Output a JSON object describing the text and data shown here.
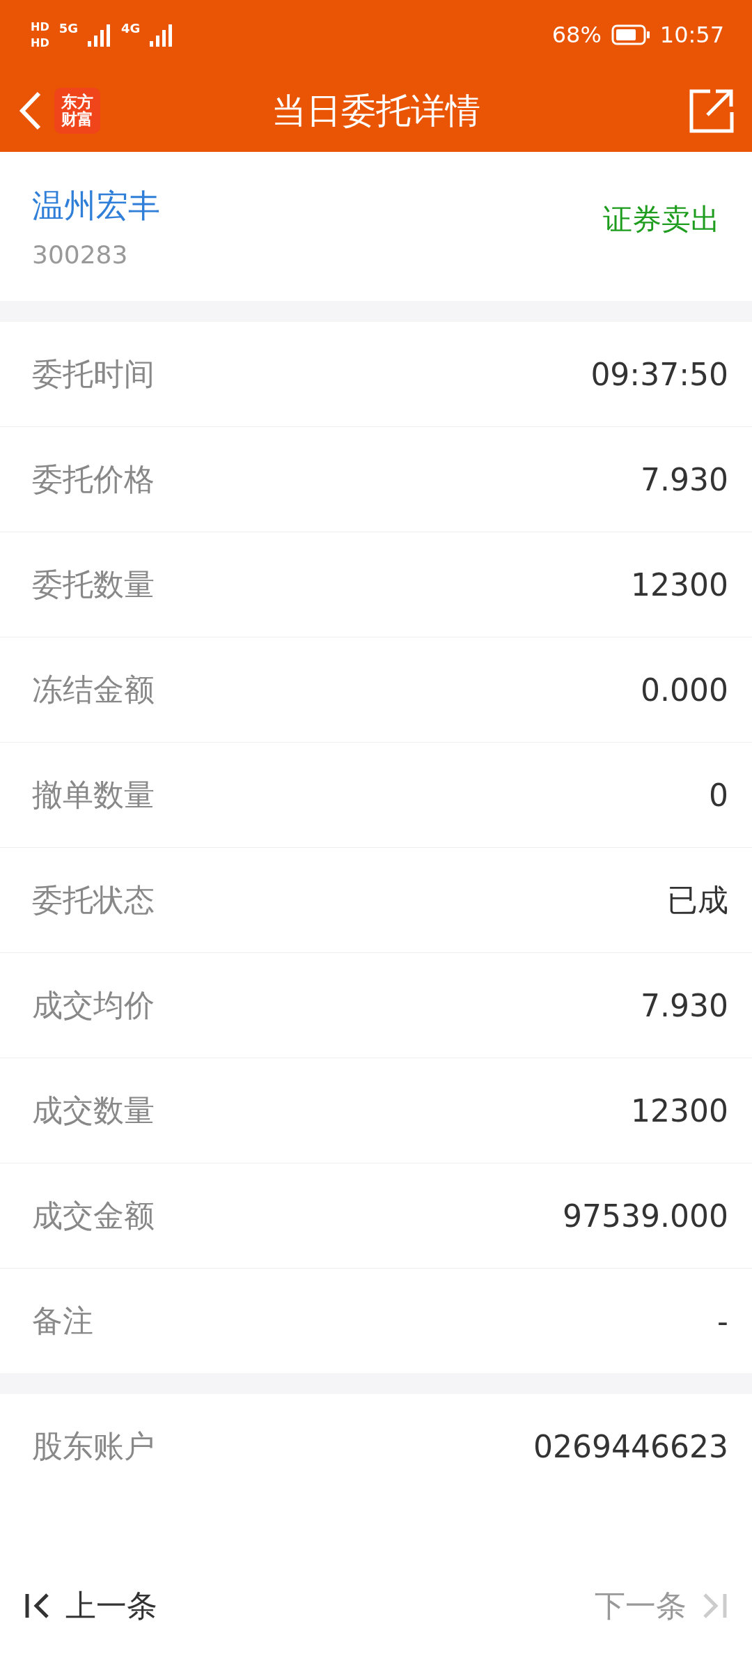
{
  "status_bar": {
    "sim_labels": [
      "HD",
      "HD"
    ],
    "network_labels": [
      "5G",
      "4G"
    ],
    "battery": "68%",
    "time": "10:57"
  },
  "header": {
    "logo_lines": [
      "东方",
      "财富"
    ],
    "title": "当日委托详情"
  },
  "stock": {
    "name": "温州宏丰",
    "code": "300283",
    "side": "证券卖出"
  },
  "details": [
    {
      "label": "委托时间",
      "value": "09:37:50"
    },
    {
      "label": "委托价格",
      "value": "7.930"
    },
    {
      "label": "委托数量",
      "value": "12300"
    },
    {
      "label": "冻结金额",
      "value": "0.000"
    },
    {
      "label": "撤单数量",
      "value": "0"
    },
    {
      "label": "委托状态",
      "value": "已成"
    },
    {
      "label": "成交均价",
      "value": "7.930"
    },
    {
      "label": "成交数量",
      "value": "12300"
    },
    {
      "label": "成交金额",
      "value": "97539.000"
    },
    {
      "label": "备注",
      "value": "-"
    }
  ],
  "account": [
    {
      "label": "股东账户",
      "value": "0269446623"
    }
  ],
  "nav": {
    "prev": {
      "label": "上一条",
      "disabled": false
    },
    "next": {
      "label": "下一条",
      "disabled": true
    }
  }
}
